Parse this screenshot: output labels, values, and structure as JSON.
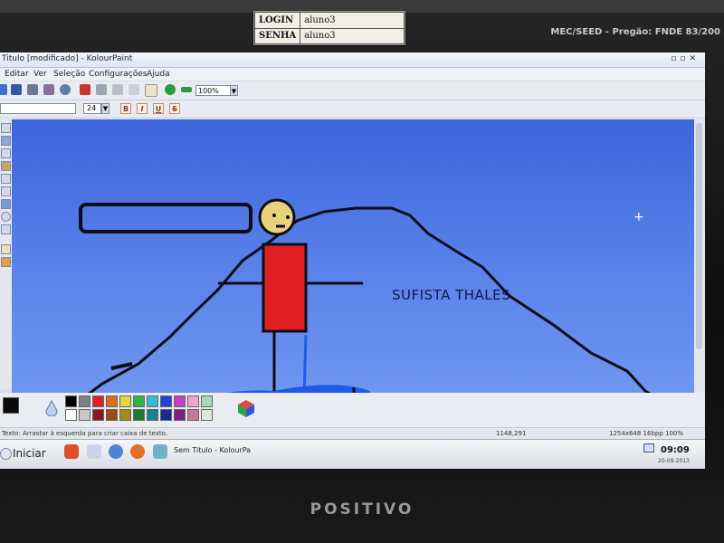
{
  "login_label": {
    "rows": [
      {
        "key": "LOGIN",
        "value": "aluno3"
      },
      {
        "key": "SENHA",
        "value": "aluno3"
      }
    ]
  },
  "bezel": {
    "top_right_text": "MEC/SEED - Pregão: FNDE 83/200",
    "brand": "POSITIVO"
  },
  "window": {
    "title": "Titulo [modificado] - KolourPaint",
    "controls_icons": [
      "minimize-icon",
      "maximize-icon",
      "close-icon"
    ]
  },
  "menu": {
    "items": [
      "Editar",
      "Ver",
      "Seleção",
      "Configurações",
      "Ajuda"
    ]
  },
  "toolbar": {
    "zoom": "100%",
    "font_size": "24",
    "format_buttons": [
      "B",
      "I",
      "U",
      "S"
    ]
  },
  "canvas": {
    "text": "SUFISTA THALES",
    "background_colors": [
      "#3d64dc",
      "#6f96ef"
    ],
    "stroke_color": "#0d0d18",
    "figure_color": "#e02020",
    "head_color": "#e8d27a",
    "shadow_color": "#1e5be8"
  },
  "palette": {
    "colors": [
      "#000000",
      "#7f7f7f",
      "#e02020",
      "#e06a1f",
      "#e8d33a",
      "#2eb34a",
      "#35b9d9",
      "#2b3ed6",
      "#c23fc9",
      "#f2a3c6",
      "#a7d8b6",
      "#ffffff",
      "#c8c8c8",
      "#8a1a1a",
      "#9b4b16",
      "#a68a15",
      "#1d7a2e",
      "#1b7f95",
      "#1b2a8c",
      "#7a1f80",
      "#c77896",
      "#d8ecd9"
    ]
  },
  "status": {
    "hint": "Texto: Arrastar à esquerda para criar caixa de texto.",
    "coords": "1148,291",
    "info": "1254x648  16bpp  100%"
  },
  "taskbar": {
    "start": "Iniciar",
    "task": "Sem Titulo - KolourPa",
    "time": "09:09",
    "date": "20-08-2013"
  }
}
